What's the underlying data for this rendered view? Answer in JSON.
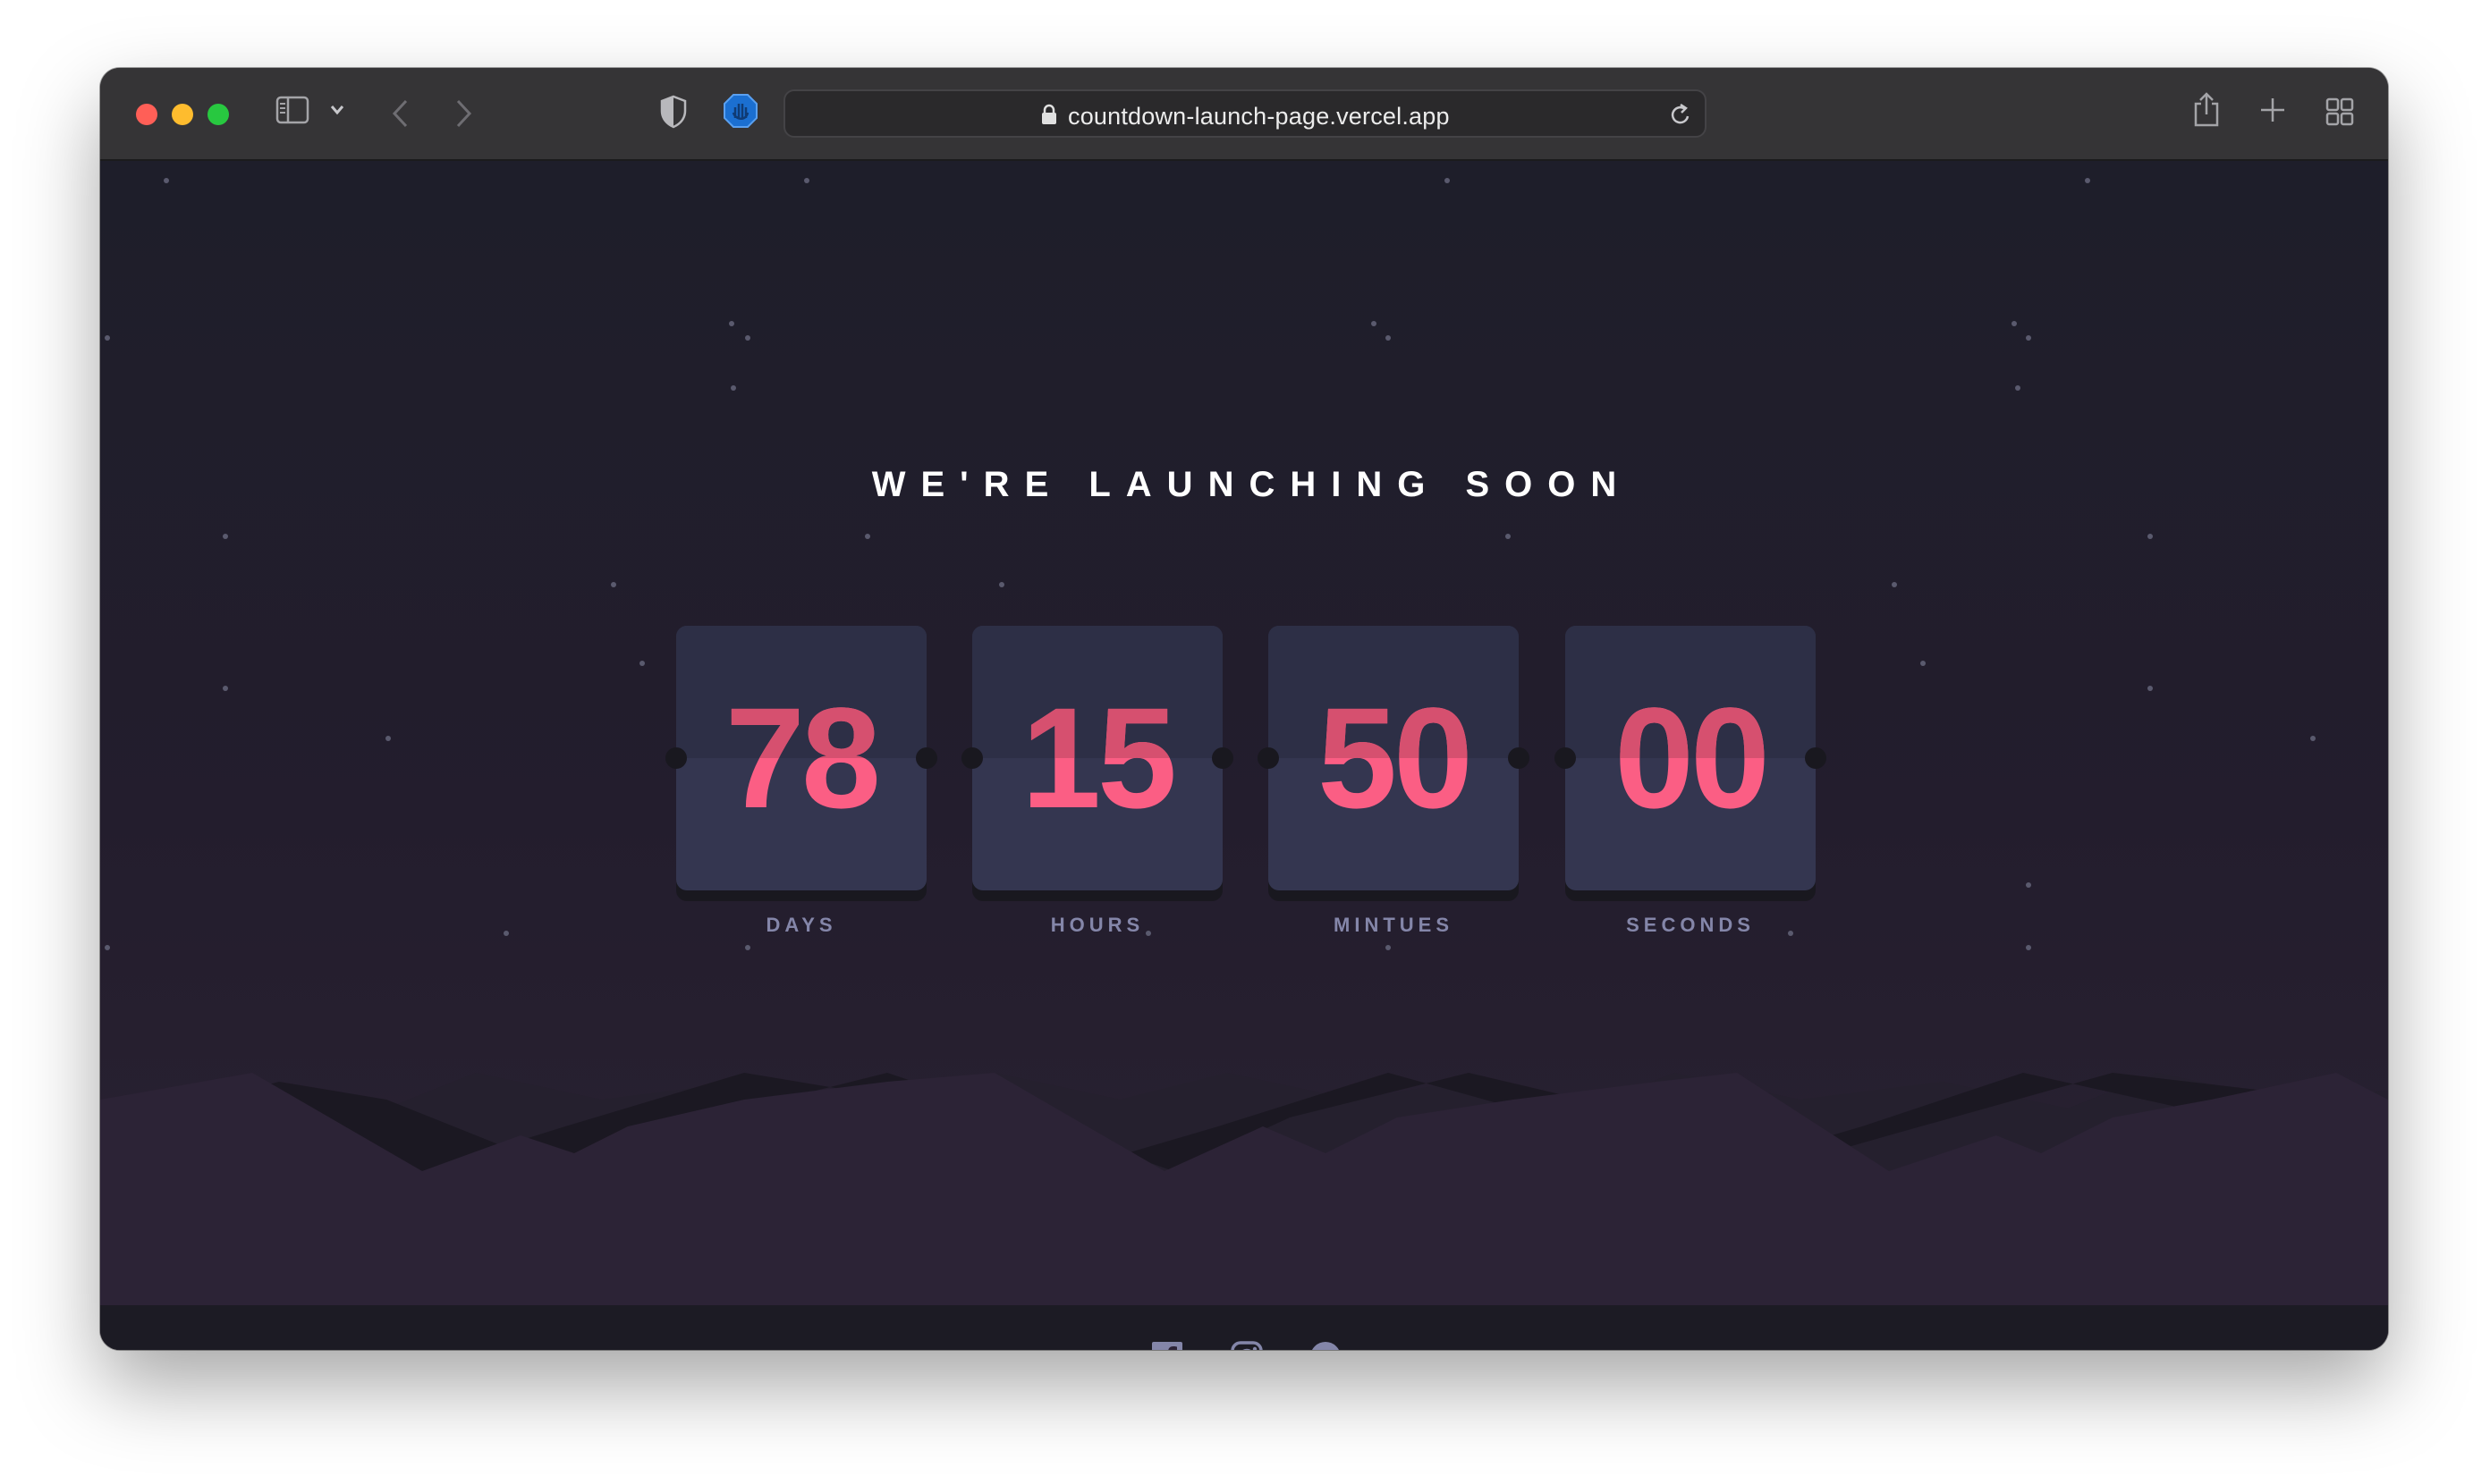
{
  "browser": {
    "url": "countdown-launch-page.vercel.app",
    "icons": [
      "sidebar-icon",
      "chevron-down-icon",
      "back-icon",
      "forward-icon",
      "shield-icon",
      "extension-icon",
      "lock-icon",
      "reload-icon",
      "share-icon",
      "new-tab-icon",
      "tab-overview-icon"
    ]
  },
  "page": {
    "headline": "WE'RE LAUNCHING SOON",
    "countdown": [
      {
        "value": "78",
        "label": "DAYS"
      },
      {
        "value": "15",
        "label": "HOURS"
      },
      {
        "value": "50",
        "label": "MINTUES"
      },
      {
        "value": "00",
        "label": "SECONDS"
      }
    ],
    "social": [
      "facebook-icon",
      "instagram-icon",
      "pinterest-icon"
    ],
    "colors": {
      "accent": "#fb5e84",
      "label": "#8486a9",
      "card": "#343650",
      "background": "#1e1e2a"
    }
  }
}
